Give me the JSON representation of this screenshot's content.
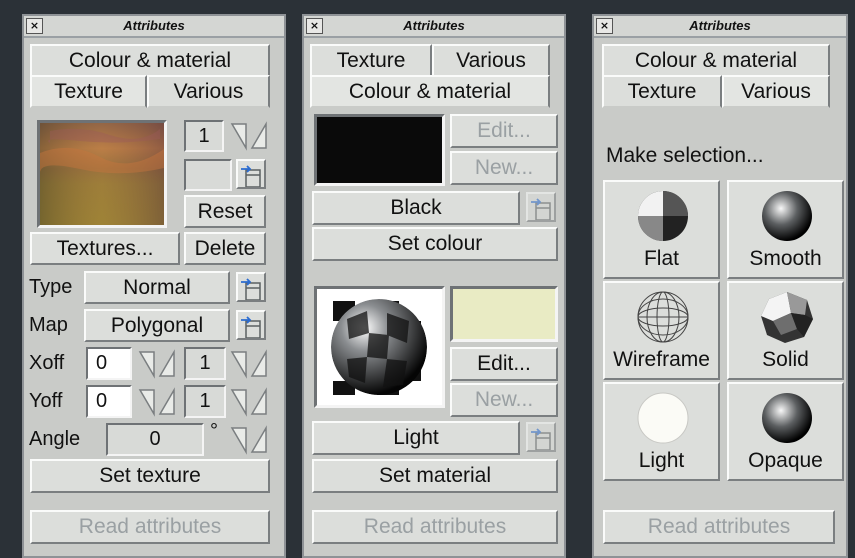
{
  "close_glyph": "×",
  "panel1": {
    "title": "Attributes",
    "tab_colour": "Colour & material",
    "tab_texture": "Texture",
    "tab_various": "Various",
    "scale_value": "1",
    "reset_label": "Reset",
    "textures_label": "Textures...",
    "delete_label": "Delete",
    "type_label": "Type",
    "type_value": "Normal",
    "map_label": "Map",
    "map_value": "Polygonal",
    "xoff_label": "Xoff",
    "xoff_value": "0",
    "xoff_scale": "1",
    "yoff_label": "Yoff",
    "yoff_value": "0",
    "yoff_scale": "1",
    "angle_label": "Angle",
    "angle_value": "0",
    "degree_symbol": "°",
    "set_label": "Set texture",
    "read_label": "Read attributes"
  },
  "panel2": {
    "title": "Attributes",
    "tab_texture": "Texture",
    "tab_various": "Various",
    "tab_colour": "Colour & material",
    "edit_label": "Edit...",
    "new_label": "New...",
    "colour_name": "Black",
    "set_colour_label": "Set colour",
    "edit2_label": "Edit...",
    "new2_label": "New...",
    "material_name": "Light",
    "set_material_label": "Set material",
    "read_label": "Read attributes"
  },
  "panel3": {
    "title": "Attributes",
    "tab_colour": "Colour & material",
    "tab_texture": "Texture",
    "tab_various": "Various",
    "prompt": "Make selection...",
    "modes": [
      "Flat",
      "Smooth",
      "Wireframe",
      "Solid",
      "Light",
      "Opaque"
    ],
    "read_label": "Read attributes"
  },
  "colors": {
    "background": "#2b3137",
    "panel": "#c9cbc8",
    "colour_swatch": "#0a0a0a",
    "light_swatch": "#e9ebc4"
  }
}
